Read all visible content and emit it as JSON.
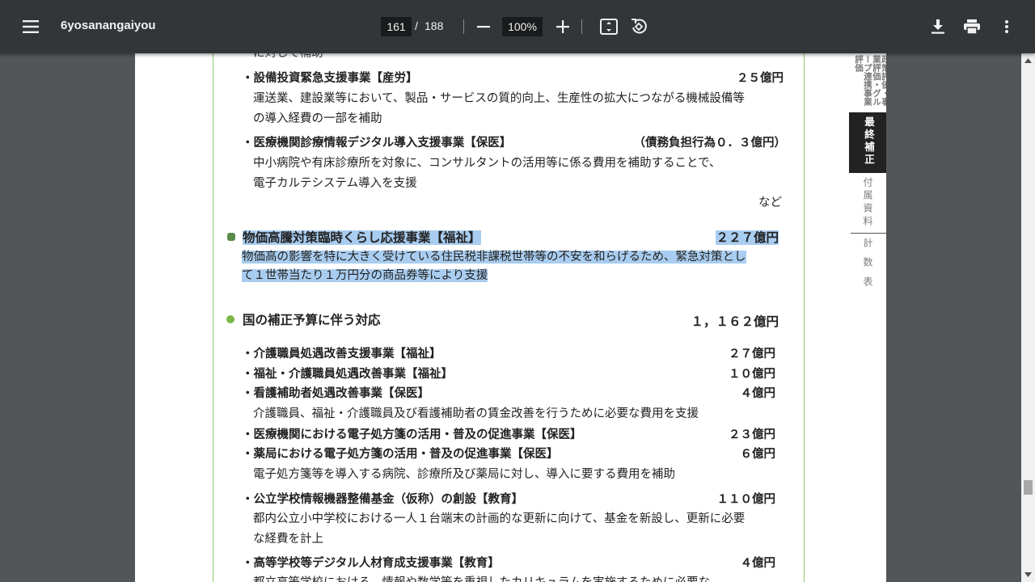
{
  "toolbar": {
    "menu_icon": "menu-icon",
    "title": "6yosanangaiyou",
    "current_page": "161",
    "page_separator": "/",
    "total_pages": "188",
    "zoom": "100%",
    "icons": [
      "zoom-out-icon",
      "zoom-in-icon",
      "fit-page-icon",
      "rotate-icon",
      "download-icon",
      "print-icon",
      "more-vert-icon"
    ]
  },
  "document": {
    "clipped_top": "に対して補助",
    "items_a": [
      {
        "label": "・設備投資緊急支援事業【産労】",
        "amount": "２５億円",
        "desc": [
          "運送業、建設業等において、製品・サービスの質的向上、生産性の拡大につながる機械設備等",
          "の導入経費の一部を補助"
        ]
      },
      {
        "label": "・医療機関診療情報デジタル導入支援事業【保医】",
        "amount": "（債務負担行為０．３億円）",
        "desc": [
          "中小病院や有床診療所を対象に、コンサルタントの活用等に係る費用を補助することで、",
          "電子カルテシステム導入を支援"
        ]
      }
    ],
    "etc": "など",
    "section1": {
      "title": "物価高騰対策臨時くらし応援事業【福祉】",
      "amount": "２２７億円",
      "desc": [
        "物価高の影響を特に大きく受けている住民税非課税世帯等の不安を和らげるため、緊急対策とし",
        "て１世帯当たり１万円分の商品券等により支援"
      ]
    },
    "section2": {
      "title": "国の補正予算に伴う対応",
      "amount": "１，１６２億円"
    },
    "items_b": [
      {
        "label": "・介護職員処遇改善支援事業【福祉】",
        "amount": "２７億円"
      },
      {
        "label": "・福祉・介護職員処遇改善事業【福祉】",
        "amount": "１０億円"
      },
      {
        "label": "・看護補助者処遇改善事業【保医】",
        "amount": "４億円"
      },
      {
        "desc": "介護職員、福祉・介護職員及び看護補助者の賃金改善を行うために必要な費用を支援"
      },
      {
        "label": "・医療機関における電子処方箋の活用・普及の促進事業【保医】",
        "amount": "２３億円"
      },
      {
        "label": "・薬局における電子処方箋の活用・普及の促進事業【保医】",
        "amount": "６億円"
      },
      {
        "desc": "電子処方箋等を導入する病院、診療所及び薬局に対し、導入に要する費用を補助"
      },
      {
        "label": "・公立学校情報機器整備基金（仮称）の創設【教育】",
        "amount": "１１０億円"
      },
      {
        "desc": "都内公立小中学校における一人１台端末の計画的な更新に向けて、基金を新設し、更新に必要"
      },
      {
        "desc": "な経費を計上"
      },
      {
        "label": "・高等学校等デジタル人材育成支援事業【教育】",
        "amount": "４億円"
      },
      {
        "desc": "都立高等学校における、情報や数学等を重視したカリキュラムを実施するために必要な"
      }
    ]
  },
  "side_tabs": {
    "top": "政策評価・事業評価・グループ連携事業評価",
    "active": "最終補正",
    "attached": "付属資料",
    "tables": "計数表"
  },
  "colors": {
    "accent_green": "#7ab648",
    "highlight": "#a9cdf0",
    "toolbar_bg": "#323639"
  }
}
